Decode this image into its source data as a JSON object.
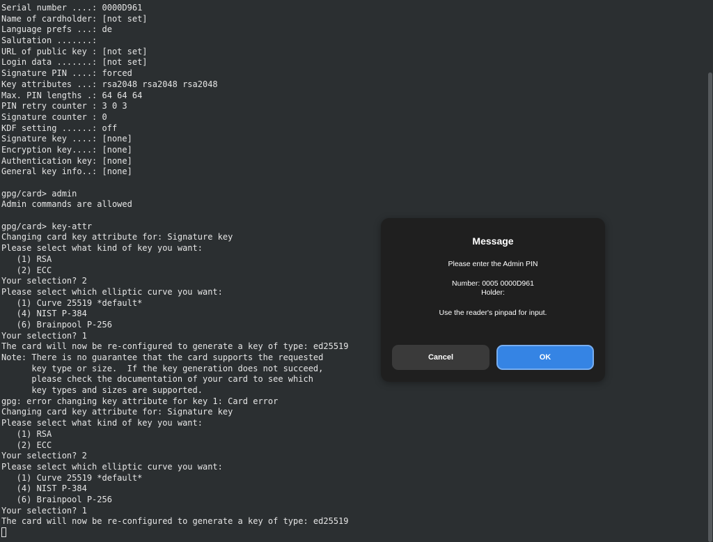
{
  "terminal": {
    "lines": [
      "Serial number ....: 0000D961",
      "Name of cardholder: [not set]",
      "Language prefs ...: de",
      "Salutation .......:",
      "URL of public key : [not set]",
      "Login data .......: [not set]",
      "Signature PIN ....: forced",
      "Key attributes ...: rsa2048 rsa2048 rsa2048",
      "Max. PIN lengths .: 64 64 64",
      "PIN retry counter : 3 0 3",
      "Signature counter : 0",
      "KDF setting ......: off",
      "Signature key ....: [none]",
      "Encryption key....: [none]",
      "Authentication key: [none]",
      "General key info..: [none]",
      "",
      "gpg/card> admin",
      "Admin commands are allowed",
      "",
      "gpg/card> key-attr",
      "Changing card key attribute for: Signature key",
      "Please select what kind of key you want:",
      "   (1) RSA",
      "   (2) ECC",
      "Your selection? 2",
      "Please select which elliptic curve you want:",
      "   (1) Curve 25519 *default*",
      "   (4) NIST P-384",
      "   (6) Brainpool P-256",
      "Your selection? 1",
      "The card will now be re-configured to generate a key of type: ed25519",
      "Note: There is no guarantee that the card supports the requested",
      "      key type or size.  If the key generation does not succeed,",
      "      please check the documentation of your card to see which",
      "      key types and sizes are supported.",
      "gpg: error changing key attribute for key 1: Card error",
      "Changing card key attribute for: Signature key",
      "Please select what kind of key you want:",
      "   (1) RSA",
      "   (2) ECC",
      "Your selection? 2",
      "Please select which elliptic curve you want:",
      "   (1) Curve 25519 *default*",
      "   (4) NIST P-384",
      "   (6) Brainpool P-256",
      "Your selection? 1",
      "The card will now be re-configured to generate a key of type: ed25519"
    ]
  },
  "dialog": {
    "title": "Message",
    "prompt": "Please enter the Admin PIN",
    "number": "Number: 0005 0000D961",
    "holder": "Holder:",
    "hint": "Use the reader's pinpad for input.",
    "cancel_label": "Cancel",
    "ok_label": "OK"
  },
  "colors": {
    "terminal_bg": "#2b2f31",
    "terminal_fg": "#e6e6e6",
    "dialog_bg": "#1f1f1f",
    "cancel_bg": "#3a3a3a",
    "ok_bg": "#3584e4"
  }
}
